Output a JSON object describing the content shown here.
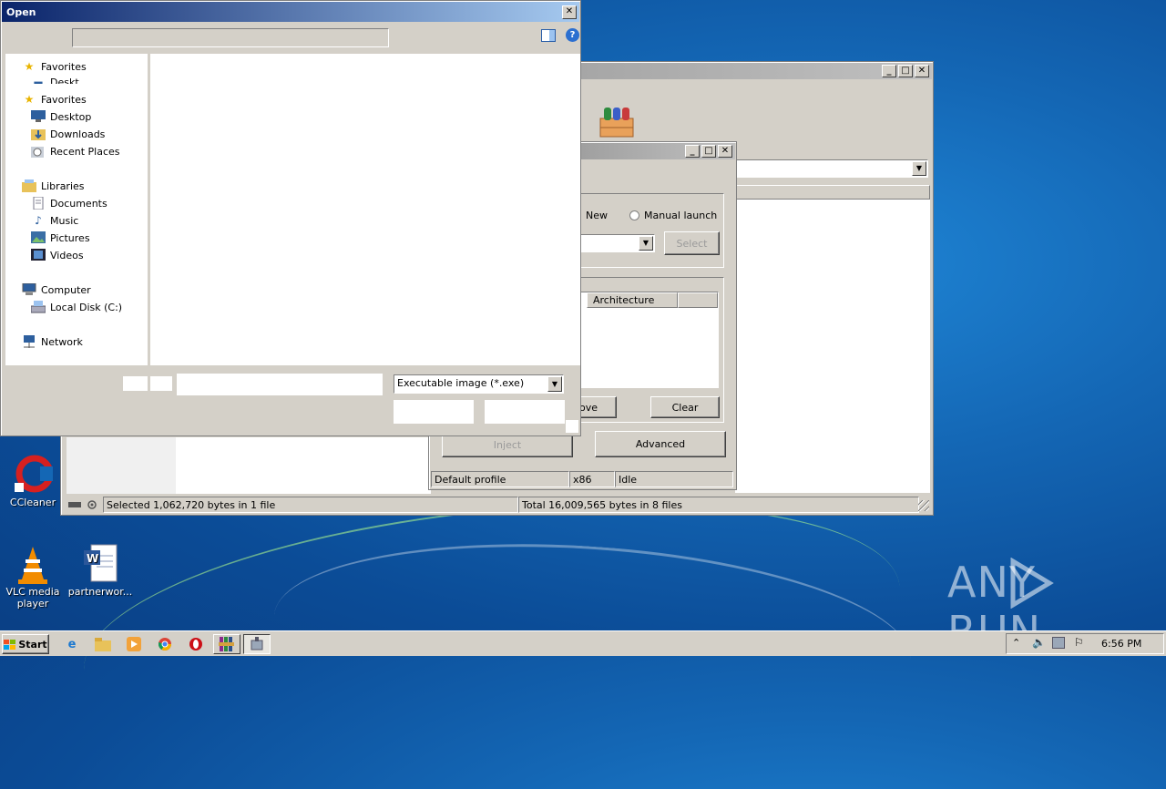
{
  "open_dialog": {
    "title": "Open",
    "close_glyph": "✕",
    "help_glyph": "?",
    "nav": [
      {
        "icon": "star-icon",
        "label": "Favorites"
      },
      {
        "icon": "desktop-icon",
        "label": "Deskt"
      },
      {
        "icon": "star-icon",
        "label": "Favorites"
      },
      {
        "icon": "desktop-icon",
        "label": "Desktop"
      },
      {
        "icon": "downloads-folder-icon",
        "label": "Downloads"
      },
      {
        "icon": "recent-places-icon",
        "label": "Recent Places"
      },
      {
        "icon": "libraries-icon",
        "label": "Libraries"
      },
      {
        "icon": "documents-icon",
        "label": "Documents"
      },
      {
        "icon": "music-icon",
        "label": "Music"
      },
      {
        "icon": "pictures-icon",
        "label": "Pictures"
      },
      {
        "icon": "videos-icon",
        "label": "Videos"
      },
      {
        "icon": "computer-icon",
        "label": "Computer"
      },
      {
        "icon": "local-disk-icon",
        "label": "Local Disk (C:)"
      },
      {
        "icon": "network-icon",
        "label": "Network"
      }
    ],
    "file_type": "Executable image (*.exe)"
  },
  "archive_window": {
    "title_buttons": [
      "_",
      "□",
      "✕"
    ],
    "status_left": "Selected 1,062,720 bytes in 1 file",
    "status_right": "Total 16,009,565 bytes in 8 files"
  },
  "injector_window": {
    "title_buttons": [
      "_",
      "□",
      "✕"
    ],
    "radio_new": "New",
    "radio_manual": "Manual launch",
    "select_button": "Select",
    "column_architecture": "Architecture",
    "remove_button": "ove",
    "clear_button": "Clear",
    "inject_button": "Inject",
    "advanced_button": "Advanced",
    "status_profile": "Default profile",
    "status_arch": "x86",
    "status_state": "Idle"
  },
  "desktop_icons": [
    {
      "label": "CCleaner"
    },
    {
      "label": "VLC media player"
    },
    {
      "label": "partnerwor..."
    }
  ],
  "taskbar": {
    "start_label": "Start",
    "clock": "6:56 PM"
  },
  "watermark": "ANY RUN"
}
